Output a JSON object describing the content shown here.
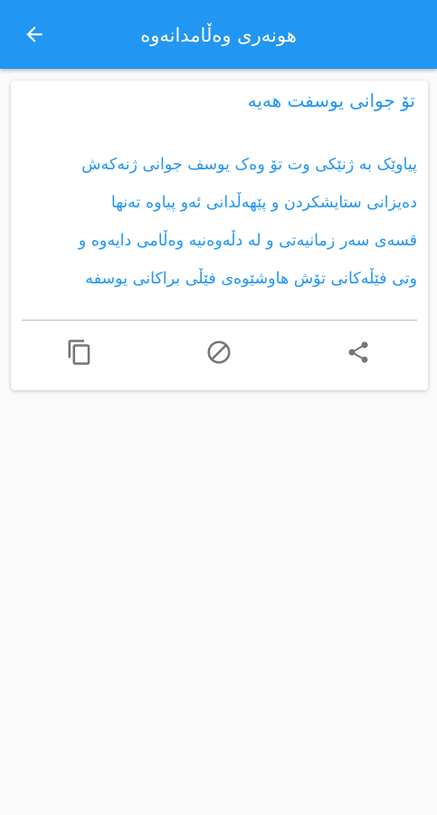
{
  "appbar": {
    "title": "هونەری وەڵامدانەوە",
    "back_icon": "arrow-back-icon"
  },
  "card": {
    "title": "تۆ جوانی یوسفت هەیە",
    "lines": [
      "پیاوێک بە ژنێکی وت تۆ وەک یوسف جوانی ژنەکەش",
      "دەیزانی ستایشکردن و پێهەڵدانی ئەو پیاوە تەنها",
      "قسەی سەر زمانیەتی و لە دڵەوەنیە وەڵامی دایەوە و",
      "وتی فێڵەکانی تۆش هاوشێوەی فێڵی براکانی یوسفە"
    ],
    "actions": {
      "copy_icon": "copy-icon",
      "block_icon": "block-icon",
      "share_icon": "share-icon"
    }
  },
  "colors": {
    "primary": "#2196f3",
    "icon_grey": "#757575",
    "background": "#fafafa"
  }
}
